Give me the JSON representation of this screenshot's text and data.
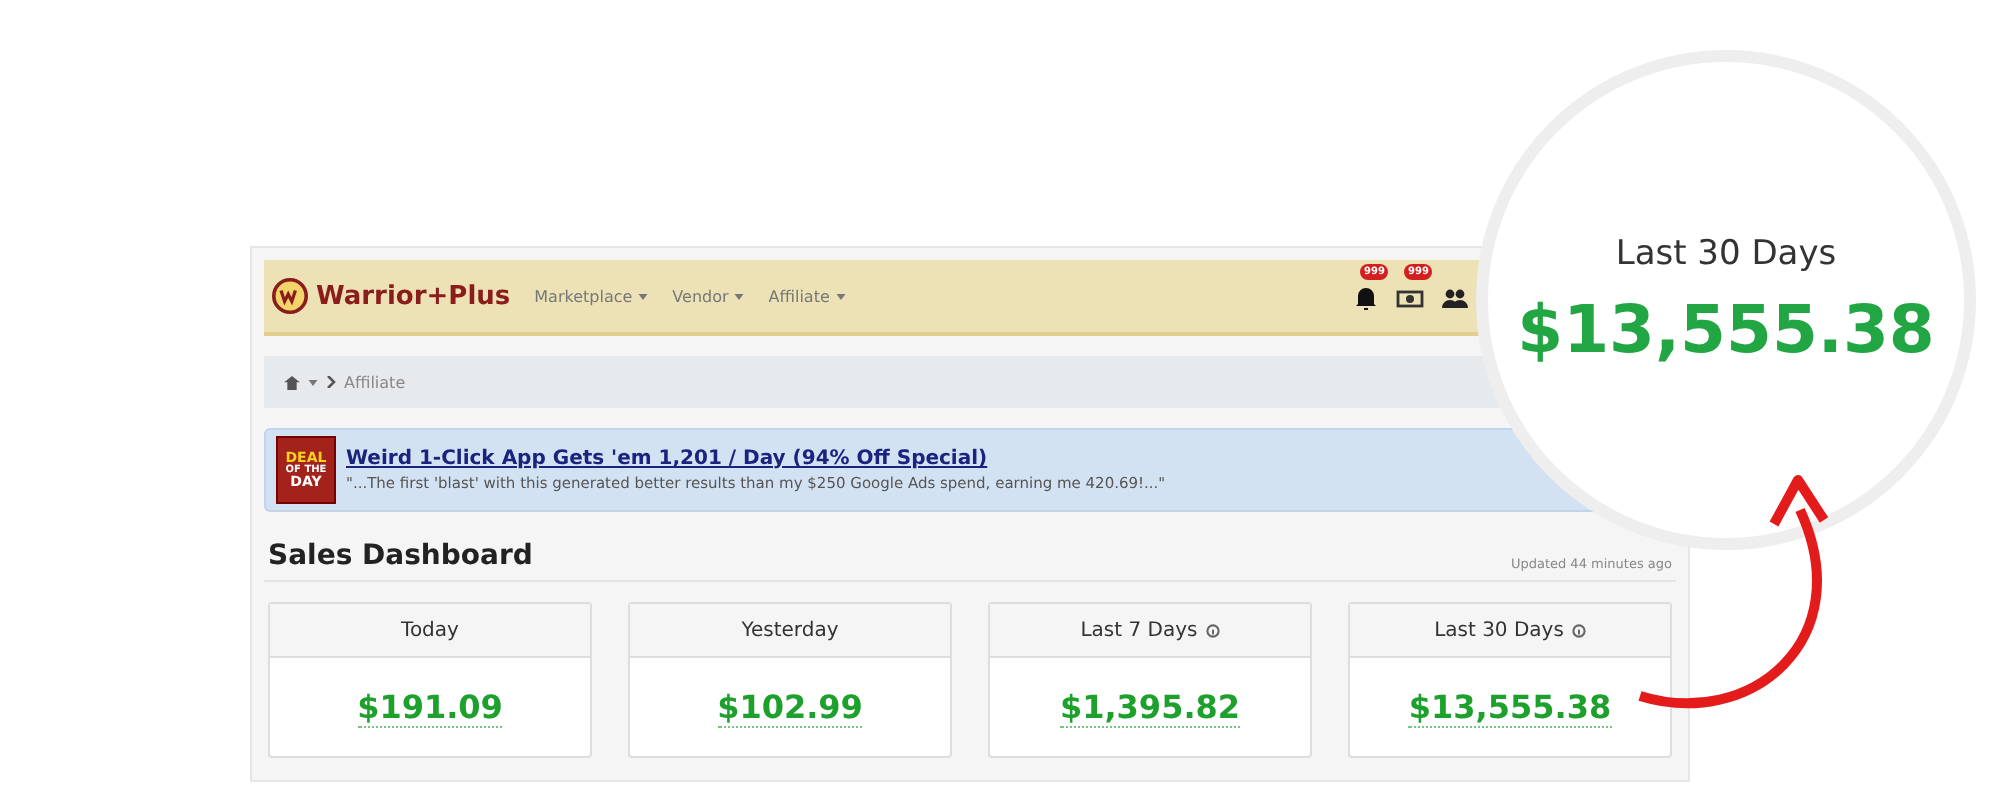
{
  "navbar": {
    "logo_text": "Warrior+Plus",
    "menus": [
      "Marketplace",
      "Vendor",
      "Affiliate"
    ],
    "badges": [
      "999",
      "999"
    ]
  },
  "breadcrumb": {
    "current": "Affiliate"
  },
  "deal": {
    "badge_lines": [
      "DEAL",
      "OF THE",
      "DAY"
    ],
    "title": "Weird 1-Click App Gets 'em 1,201 / Day (94% Off Special)",
    "quote": "\"...The first 'blast' with this generated better results than my $250 Google Ads spend, earning me 420.69!...\""
  },
  "dashboard": {
    "title": "Sales Dashboard",
    "updated": "Updated 44 minutes ago",
    "cards": [
      {
        "label": "Today",
        "value": "$191.09",
        "info": false
      },
      {
        "label": "Yesterday",
        "value": "$102.99",
        "info": false
      },
      {
        "label": "Last 7 Days",
        "value": "$1,395.82",
        "info": true
      },
      {
        "label": "Last 30 Days",
        "value": "$13,555.38",
        "info": true
      }
    ]
  },
  "callout": {
    "label": "Last 30 Days",
    "value": "$13,555.38"
  }
}
